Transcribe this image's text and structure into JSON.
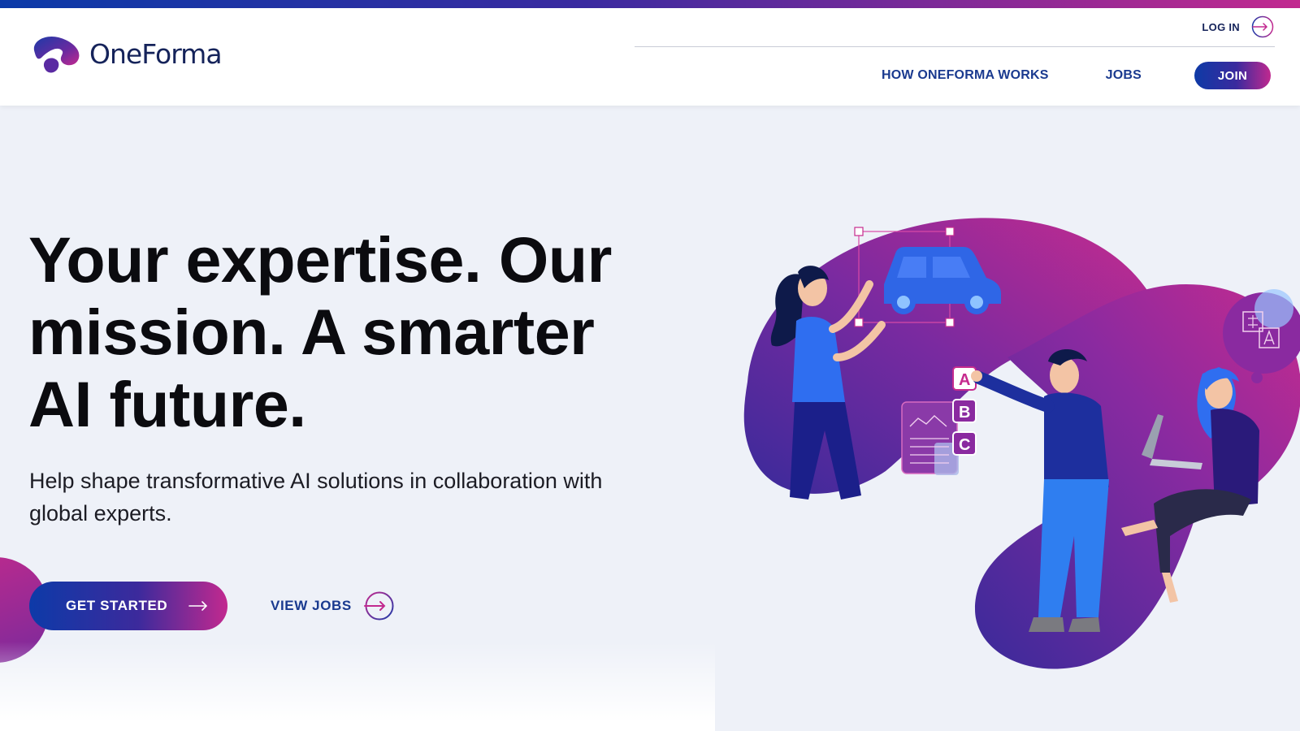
{
  "brand": {
    "name": "OneForma",
    "gradient_start": "#0b3aa8",
    "gradient_end": "#c2298f",
    "navy": "#15235a",
    "link_blue": "#1a3a8f"
  },
  "header": {
    "login_label": "LOG IN",
    "login_icon": "circle-arrow-right-icon",
    "nav": [
      {
        "label": "HOW ONEFORMA WORKS"
      },
      {
        "label": "JOBS"
      }
    ],
    "join_label": "JOIN"
  },
  "hero": {
    "title": "Your expertise. Our mission. A smarter AI future.",
    "subtitle": "Help shape transformative AI solutions in collaboration with global experts.",
    "primary_cta": {
      "label": "GET STARTED",
      "icon": "arrow-right-icon"
    },
    "secondary_cta": {
      "label": "VIEW JOBS",
      "icon": "circle-arrow-right-icon"
    }
  },
  "illustration": {
    "option_labels": [
      "A",
      "B",
      "C"
    ],
    "icons": [
      "car-icon",
      "document-chart-icon",
      "translate-icon"
    ]
  }
}
